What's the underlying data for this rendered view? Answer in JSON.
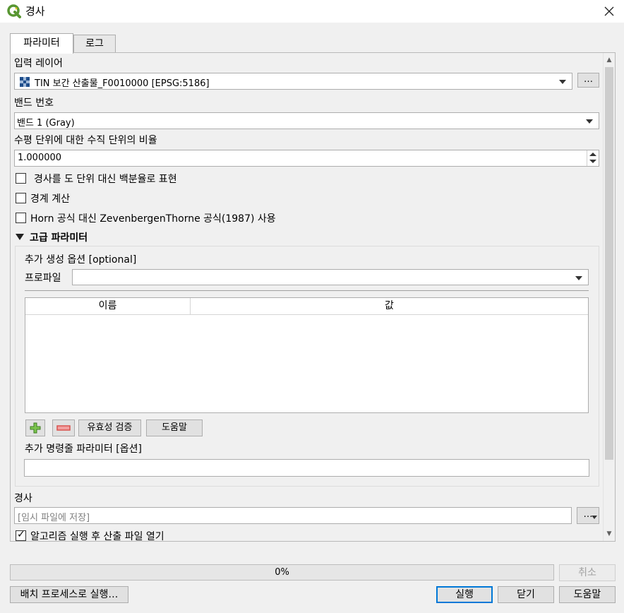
{
  "window": {
    "title": "경사"
  },
  "tabs": [
    {
      "label": "파라미터"
    },
    {
      "label": "로그"
    }
  ],
  "params": {
    "input_layer_label": "입력 레이어",
    "input_layer_value": "TIN 보간 산출물_F0010000 [EPSG:5186]",
    "more_button": "…",
    "band_label": "밴드 번호",
    "band_value": "밴드 1 (Gray)",
    "ratio_label": "수평 단위에 대한 수직 단위의 비율",
    "ratio_value": "1.000000",
    "cb_percent_label": "경사를 도 단위 대신 백분율로 표현",
    "cb_percent_checked": false,
    "cb_edges_label": "경계 계산",
    "cb_edges_checked": false,
    "cb_zevenbergen_label": "Horn 공식 대신 ZevenbergenThorne 공식(1987) 사용",
    "cb_zevenbergen_checked": false
  },
  "advanced": {
    "header": "고급 파라미터",
    "creation_options_label": "추가 생성 옵션 [optional]",
    "profile_label": "프로파일",
    "profile_value": "",
    "table_columns": [
      "이름",
      "값"
    ],
    "validate_button": "유효성 검증",
    "help_button": "도움말",
    "extra_cmd_label": "추가 명령줄 파라미터 [옵션]",
    "extra_cmd_value": ""
  },
  "output": {
    "label": "경사",
    "placeholder": "[임시 파일에 저장]",
    "more_button": "…",
    "open_after_label": "알고리즘 실행 후 산출 파일 열기",
    "open_after_checked": true
  },
  "progress": {
    "value": 0,
    "text": "0%"
  },
  "buttons": {
    "cancel": "취소",
    "batch": "배치 프로세스로 실행…",
    "run": "실행",
    "close": "닫기",
    "help": "도움말"
  },
  "colors": {
    "qgis_green": "#589632",
    "add_green": "#4a9a2e",
    "remove_red": "#d9534f",
    "default_blue": "#0078d7"
  }
}
